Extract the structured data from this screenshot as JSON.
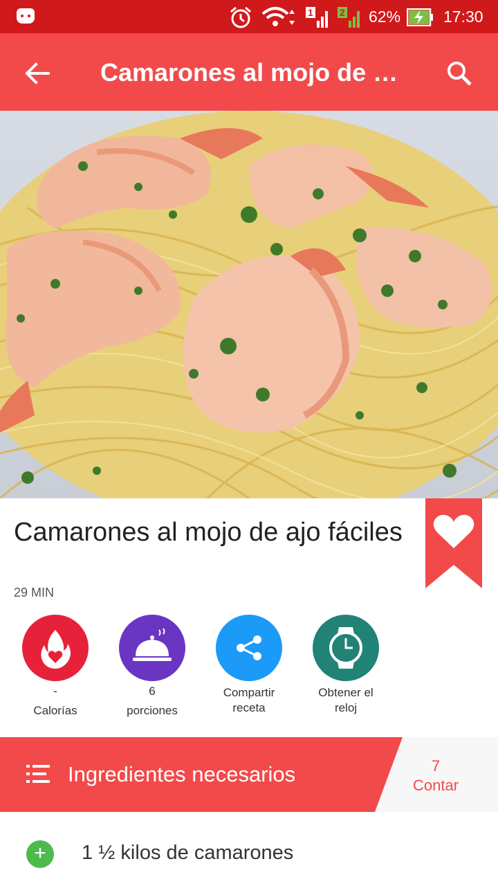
{
  "status_bar": {
    "battery_percent": "62%",
    "time": "17:30",
    "sim1_label": "1",
    "sim2_label": "2",
    "icons": [
      "android-icon",
      "alarm-icon",
      "wifi-icon",
      "signal-sim1-icon",
      "signal-sim2-icon",
      "battery-charging-icon"
    ]
  },
  "app_bar": {
    "title": "Camarones al mojo de ajo fáciles",
    "back_icon": "arrow-back-icon",
    "search_icon": "search-icon",
    "color": "#f24a4a"
  },
  "recipe": {
    "title": "Camarones al mojo de ajo fáciles",
    "time": "29 MIN",
    "bookmark_icon": "heart-icon"
  },
  "actions": [
    {
      "value": "-",
      "label": "Calorías",
      "icon": "calories-flame-icon",
      "color": "#e8213a"
    },
    {
      "value": "6",
      "label": "porciones",
      "icon": "serving-dish-icon",
      "color": "#6a35c2"
    },
    {
      "value": "",
      "label": "Compartir receta",
      "icon": "share-icon",
      "color": "#1b9af7"
    },
    {
      "value": "",
      "label": "Obtener el reloj",
      "icon": "watch-icon",
      "color": "#218276"
    }
  ],
  "ingredients_header": {
    "label": "Ingredientes necesarios",
    "count": "7",
    "count_label": "Contar"
  },
  "ingredients": [
    {
      "text": "1 ½ kilos de camarones"
    }
  ]
}
